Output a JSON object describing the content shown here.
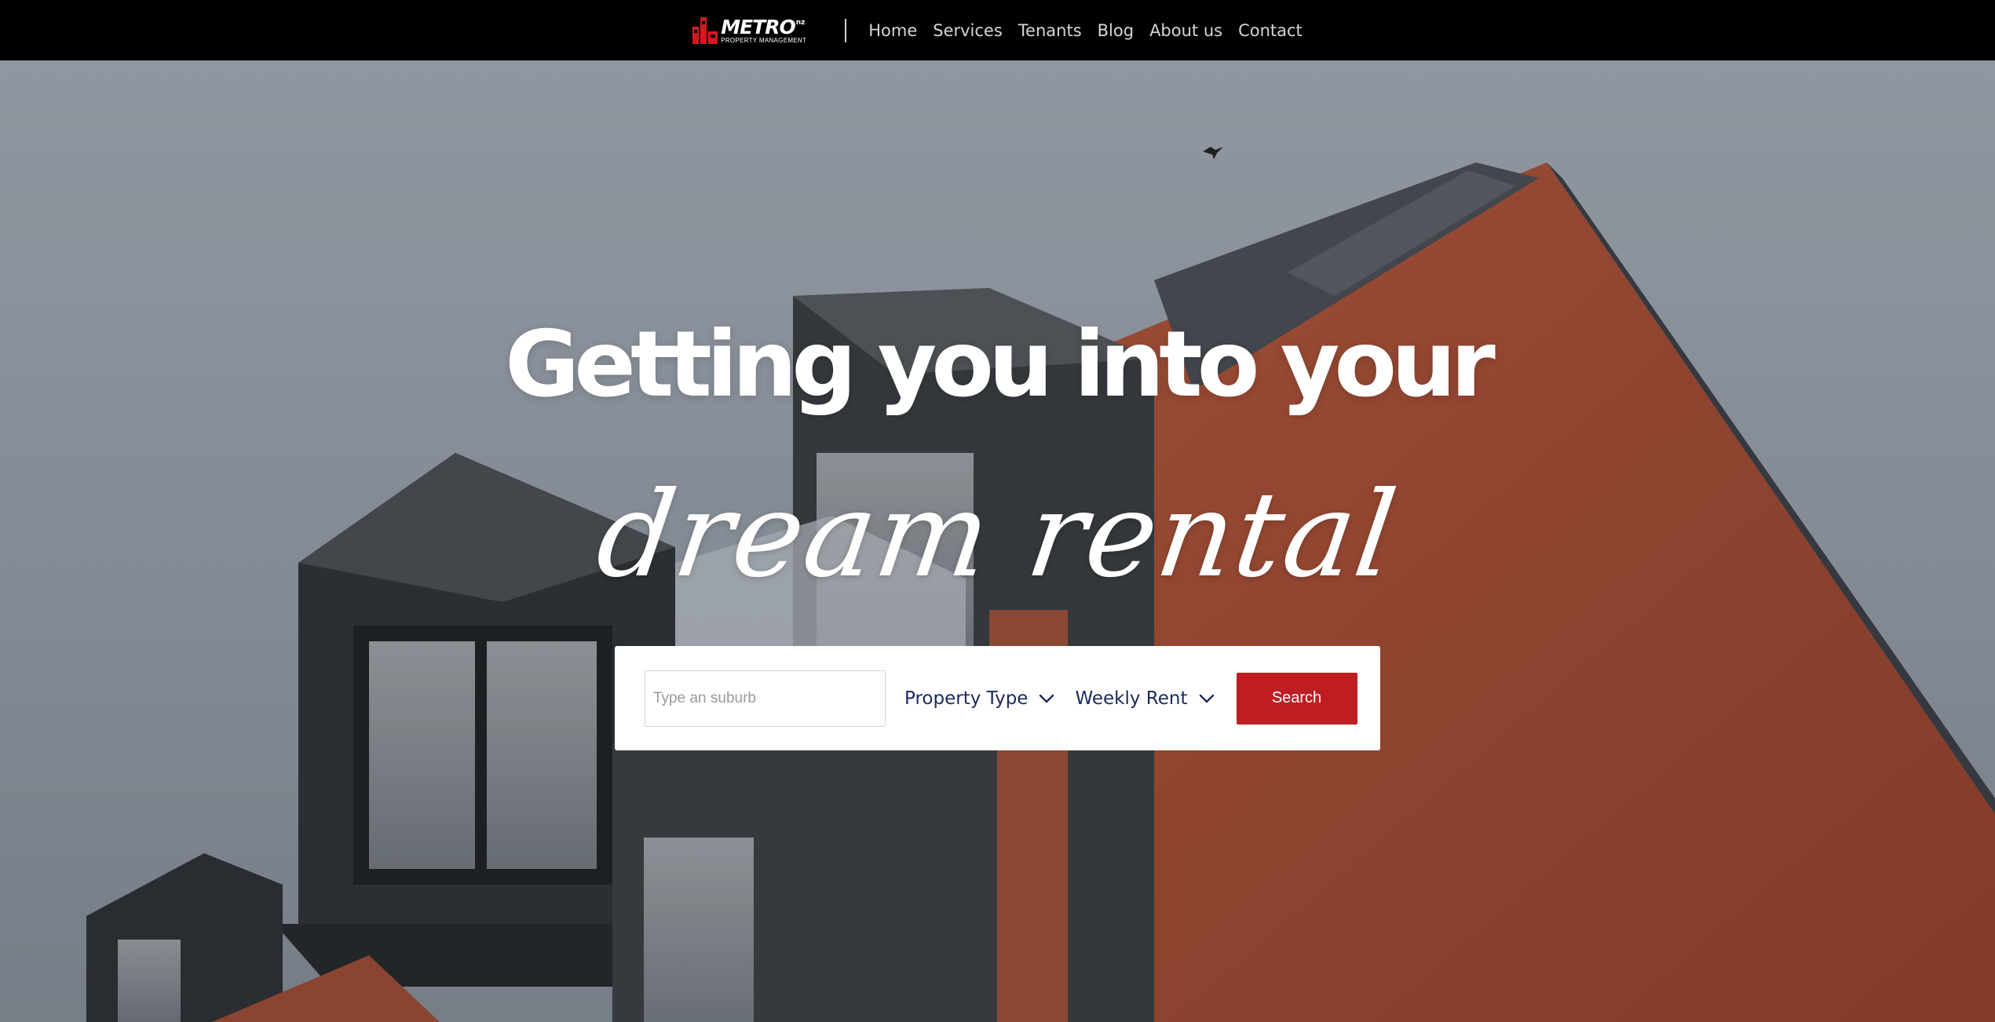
{
  "nav": {
    "logo": {
      "wordmark": "METRO",
      "suffix": "nz",
      "tagline": "PROPERTY MANAGEMENT"
    },
    "links": [
      "Home",
      "Services",
      "Tenants",
      "Blog",
      "About us",
      "Contact"
    ]
  },
  "hero": {
    "headline": "Getting you into your",
    "script_text": "dream rental"
  },
  "search": {
    "suburb_placeholder": "Type an suburb",
    "suburb_value": "",
    "property_type_label": "Property Type",
    "weekly_rent_label": "Weekly Rent",
    "button_label": "Search"
  },
  "colors": {
    "accent": "#be1e22",
    "nav_background": "#000000",
    "select_text": "#1d2a5c"
  },
  "icons": {
    "property_type": "chevron-down-icon",
    "weekly_rent": "chevron-down-icon"
  }
}
